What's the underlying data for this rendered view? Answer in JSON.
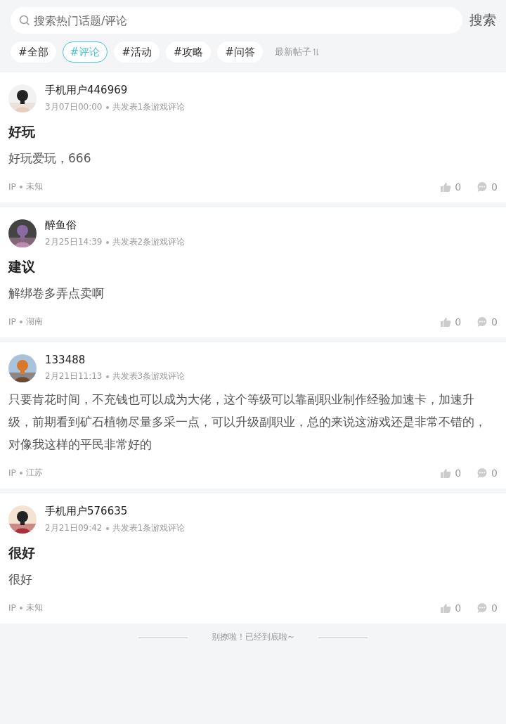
{
  "search": {
    "placeholder": "搜索热门话题/评论",
    "button": "搜索"
  },
  "tags": [
    {
      "label": "#全部",
      "selected": false
    },
    {
      "label": "#评论",
      "selected": true
    },
    {
      "label": "#活动",
      "selected": false
    },
    {
      "label": "#攻略",
      "selected": false
    },
    {
      "label": "#问答",
      "selected": false
    }
  ],
  "sort": {
    "label": "最新帖子"
  },
  "posts": [
    {
      "user": "手机用户446969",
      "time": "3月07日00:00",
      "summary": "共发表1条游戏评论",
      "title": "好玩",
      "body": "好玩爱玩，666",
      "ip_label": "IP",
      "ip": "未知",
      "likes": "0",
      "comments": "0"
    },
    {
      "user": "醉鱼俗",
      "time": "2月25日14:39",
      "summary": "共发表2条游戏评论",
      "title": "建议",
      "body": "解绑卷多弄点卖啊",
      "ip_label": "IP",
      "ip": "湖南",
      "likes": "0",
      "comments": "0"
    },
    {
      "user": "133488",
      "time": "2月21日11:13",
      "summary": "共发表3条游戏评论",
      "body": "只要肯花时间，不充钱也可以成为大佬，这个等级可以靠副职业制作经验加速卡，加速升级，前期看到矿石植物尽量多采一点，可以升级副职业，总的来说这游戏还是非常不错的，对像我这样的平民非常好的",
      "ip_label": "IP",
      "ip": "江苏",
      "likes": "0",
      "comments": "0"
    },
    {
      "user": "手机用户576635",
      "time": "2月21日09:42",
      "summary": "共发表1条游戏评论",
      "title": "很好",
      "body": "很好",
      "ip_label": "IP",
      "ip": "未知",
      "likes": "0",
      "comments": "0"
    }
  ],
  "end_note": "别撩啦！已经到底啦~"
}
